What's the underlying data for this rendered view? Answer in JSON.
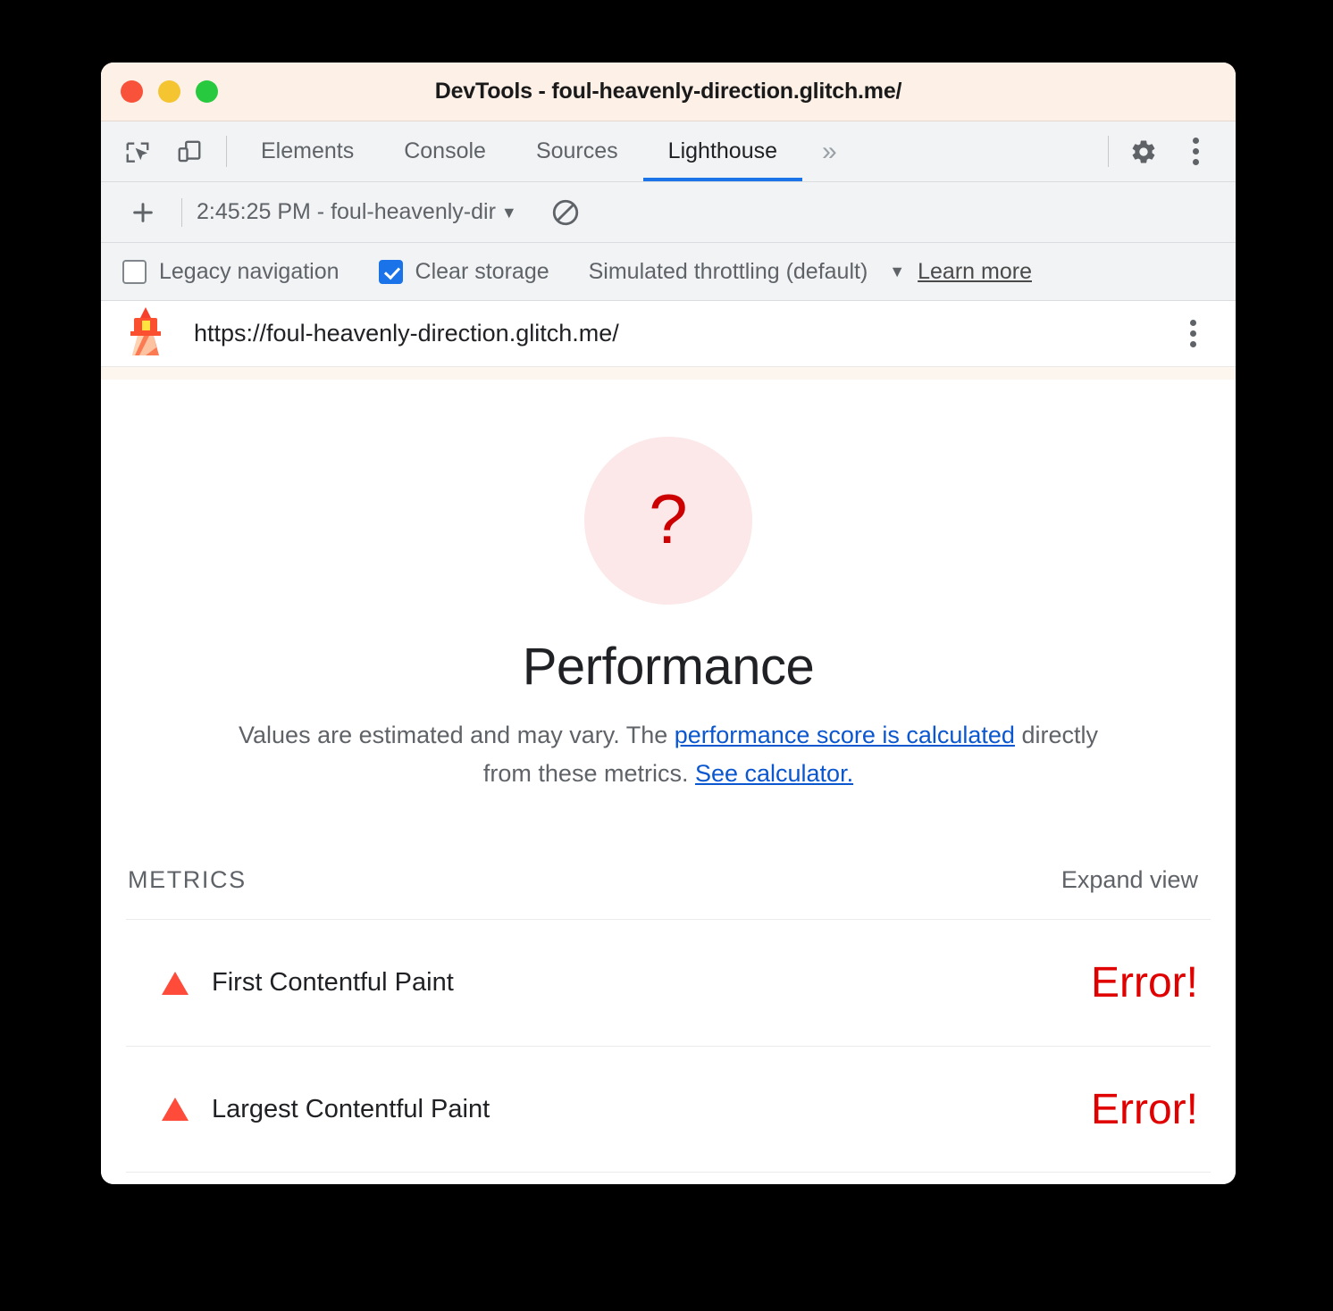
{
  "window": {
    "title": "DevTools - foul-heavenly-direction.glitch.me/",
    "traffic_lights": [
      "close",
      "minimize",
      "maximize"
    ]
  },
  "devtools": {
    "left_icons": [
      {
        "name": "inspect-element-icon",
        "label": "Inspect element"
      },
      {
        "name": "device-toolbar-icon",
        "label": "Toggle device toolbar"
      }
    ],
    "tabs": [
      {
        "label": "Elements",
        "active": false
      },
      {
        "label": "Console",
        "active": false
      },
      {
        "label": "Sources",
        "active": false
      },
      {
        "label": "Lighthouse",
        "active": true
      }
    ],
    "overflow_label": "»",
    "right_icons": [
      {
        "name": "settings-gear-icon",
        "label": "Settings"
      },
      {
        "name": "more-options-icon",
        "label": "Customize and control DevTools"
      }
    ],
    "active_tab_color": "#1a73e8"
  },
  "run_toolbar": {
    "new_report_label": "+",
    "selected_run": "2:45:25 PM - foul-heavenly-dir",
    "caret": "▼",
    "clear_label": "Clear all"
  },
  "options": {
    "legacy_navigation": {
      "label": "Legacy navigation",
      "checked": false
    },
    "clear_storage": {
      "label": "Clear storage",
      "checked": true
    },
    "throttling": {
      "label": "Simulated throttling (default)",
      "caret": "▼"
    },
    "learn_more": "Learn more",
    "checked_color": "#1a73e8"
  },
  "url_bar": {
    "logo_name": "lighthouse-logo-icon",
    "url": "https://foul-heavenly-direction.glitch.me/",
    "kebab_label": "More options"
  },
  "report": {
    "gauge": {
      "score_symbol": "?",
      "circle_color": "#fce8e9",
      "symbol_color": "#cc0000"
    },
    "category_title": "Performance",
    "description": {
      "before": "Values are estimated and may vary. The ",
      "link1": "performance score is calculated",
      "middle": " directly from these metrics. ",
      "link2": "See calculator."
    },
    "metrics_header": "METRICS",
    "expand_view": "Expand view",
    "metrics": [
      {
        "icon": "fail-triangle-icon",
        "name": "First Contentful Paint",
        "value": "Error!",
        "status": "error"
      },
      {
        "icon": "fail-triangle-icon",
        "name": "Largest Contentful Paint",
        "value": "Error!",
        "status": "error"
      }
    ],
    "error_color": "#e00000",
    "triangle_color": "#ff4b3a"
  }
}
